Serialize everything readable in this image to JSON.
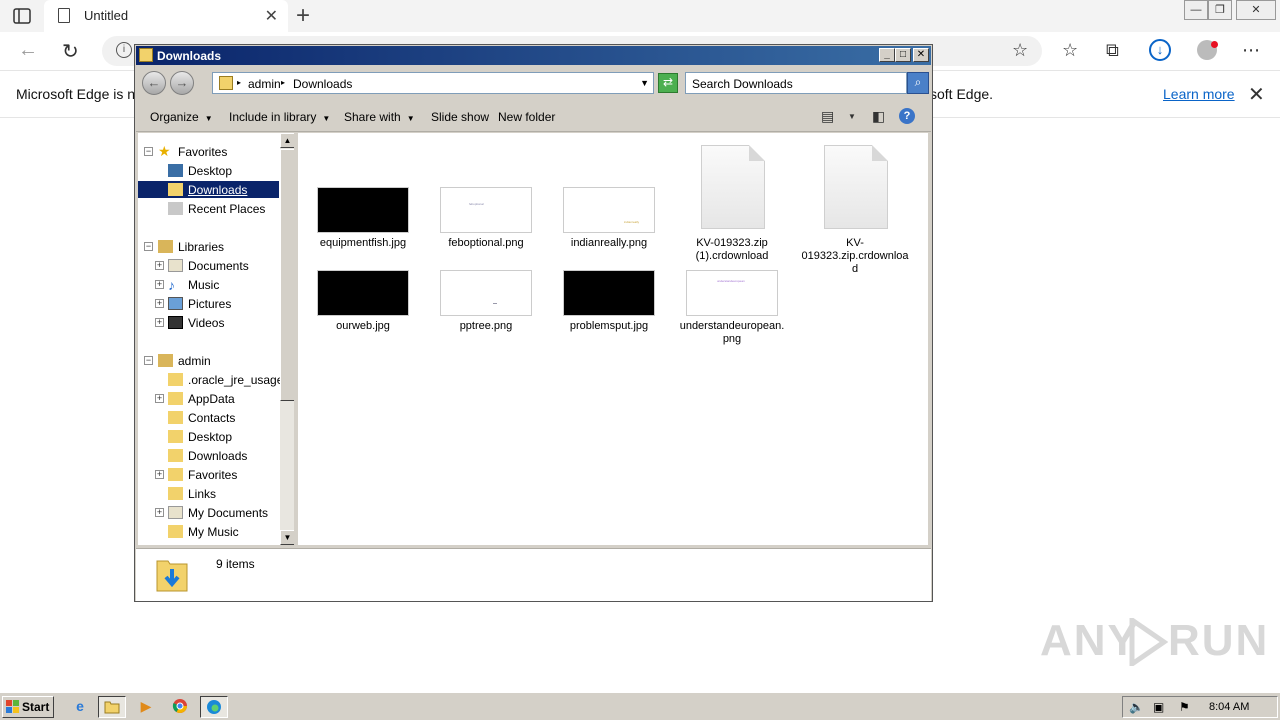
{
  "browser": {
    "tab_title": "Untitled",
    "infobar_message_start": "Microsoft Edge is no",
    "infobar_message_end": "soft Edge.",
    "learn_more": "Learn more"
  },
  "explorer": {
    "title": "Downloads",
    "breadcrumb": [
      "admin",
      "Downloads"
    ],
    "search_placeholder": "Search Downloads",
    "commands": {
      "organize": "Organize",
      "include_in_library": "Include in library",
      "share_with": "Share with",
      "slide_show": "Slide show",
      "new_folder": "New folder"
    },
    "nav": {
      "favorites": "Favorites",
      "desktop": "Desktop",
      "downloads": "Downloads",
      "recent_places": "Recent Places",
      "libraries": "Libraries",
      "documents": "Documents",
      "music": "Music",
      "pictures": "Pictures",
      "videos": "Videos",
      "admin": "admin",
      "oracle": ".oracle_jre_usage",
      "appdata": "AppData",
      "contacts": "Contacts",
      "desktop2": "Desktop",
      "downloads2": "Downloads",
      "favorites2": "Favorites",
      "links": "Links",
      "my_documents": "My Documents",
      "my_music": "My Music"
    },
    "files": [
      {
        "name": "equipmentfish.jpg",
        "kind": "dark"
      },
      {
        "name": "feboptional.png",
        "kind": "light"
      },
      {
        "name": "indianreally.png",
        "kind": "light"
      },
      {
        "name": "KV-019323.zip (1).crdownload",
        "kind": "doc"
      },
      {
        "name": "KV-019323.zip.crdownload",
        "kind": "doc"
      },
      {
        "name": "ourweb.jpg",
        "kind": "dark"
      },
      {
        "name": "pptree.png",
        "kind": "light"
      },
      {
        "name": "problemsput.jpg",
        "kind": "dark"
      },
      {
        "name": "understandeuropean.png",
        "kind": "light"
      }
    ],
    "thumb_text": {
      "feboptional": "feboptional",
      "indianreally": "indianreally",
      "understandeuropean": "understandeuropean"
    },
    "status_count": "9 items"
  },
  "watermark": {
    "left": "ANY",
    "right": "RUN"
  },
  "taskbar": {
    "start": "Start",
    "clock": "8:04 AM"
  },
  "colors": {
    "accent": "#0a246a",
    "edge_blue": "#0a64c8"
  }
}
